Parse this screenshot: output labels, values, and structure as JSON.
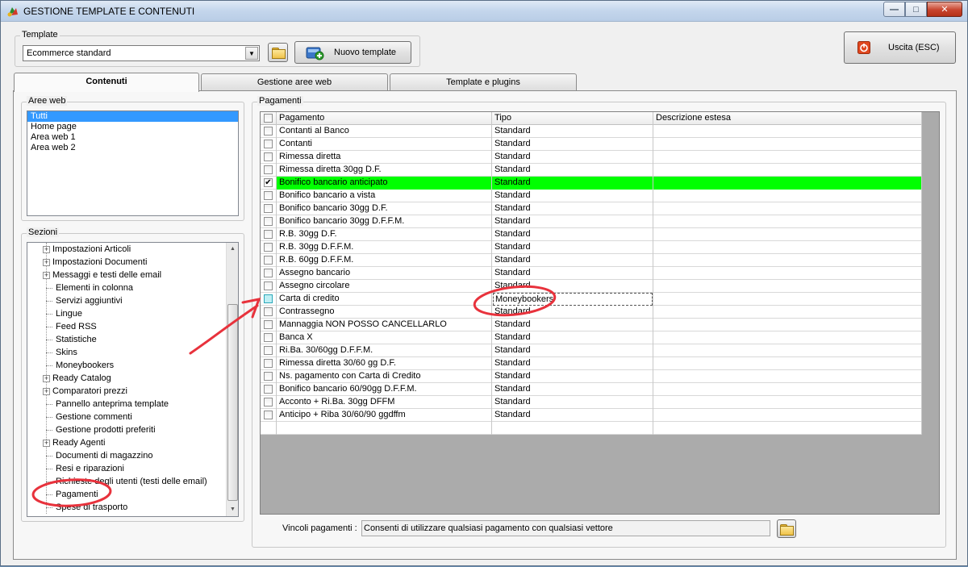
{
  "window": {
    "title": "GESTIONE TEMPLATE E CONTENUTI",
    "min_glyph": "—",
    "max_glyph": "□",
    "close_glyph": "✕"
  },
  "template": {
    "group_label": "Template",
    "selected": "Ecommerce standard",
    "new_button": "Nuovo template"
  },
  "exit_button": "Uscita (ESC)",
  "tabs": [
    {
      "label": "Contenuti",
      "active": true
    },
    {
      "label": "Gestione aree web",
      "active": false
    },
    {
      "label": "Template e plugins",
      "active": false
    }
  ],
  "aree_web": {
    "label": "Aree web",
    "items": [
      "Tutti",
      "Home page",
      "Area web 1",
      "Area web 2"
    ],
    "selected_index": 0
  },
  "sezioni": {
    "label": "Sezioni",
    "items": [
      {
        "label": "Impostazioni Articoli",
        "expandable": true
      },
      {
        "label": "Impostazioni Documenti",
        "expandable": true
      },
      {
        "label": "Messaggi e testi delle email",
        "expandable": true
      },
      {
        "label": "Elementi in colonna",
        "expandable": false
      },
      {
        "label": "Servizi aggiuntivi",
        "expandable": false
      },
      {
        "label": "Lingue",
        "expandable": false
      },
      {
        "label": "Feed RSS",
        "expandable": false
      },
      {
        "label": "Statistiche",
        "expandable": false
      },
      {
        "label": "Skins",
        "expandable": false
      },
      {
        "label": "Moneybookers",
        "expandable": false
      },
      {
        "label": "Ready Catalog",
        "expandable": true
      },
      {
        "label": "Comparatori prezzi",
        "expandable": true
      },
      {
        "label": "Pannello anteprima template",
        "expandable": false
      },
      {
        "label": "Gestione commenti",
        "expandable": false
      },
      {
        "label": "Gestione prodotti preferiti",
        "expandable": false
      },
      {
        "label": "Ready Agenti",
        "expandable": true
      },
      {
        "label": "Documenti di magazzino",
        "expandable": false
      },
      {
        "label": "Resi e riparazioni",
        "expandable": false
      },
      {
        "label": "Richieste degli utenti (testi delle email)",
        "expandable": false
      },
      {
        "label": "Pagamenti",
        "expandable": false
      },
      {
        "label": "Spese di trasporto",
        "expandable": false
      }
    ]
  },
  "pagamenti": {
    "label": "Pagamenti",
    "columns": [
      "Pagamento",
      "Tipo",
      "Descrizione estesa"
    ],
    "rows": [
      {
        "name": "Contanti al Banco",
        "tipo": "Standard",
        "checked": false
      },
      {
        "name": "Contanti",
        "tipo": "Standard",
        "checked": false
      },
      {
        "name": "Rimessa diretta",
        "tipo": "Standard",
        "checked": false
      },
      {
        "name": "Rimessa diretta 30gg D.F.",
        "tipo": "Standard",
        "checked": false
      },
      {
        "name": "Bonifico bancario anticipato",
        "tipo": "Standard",
        "checked": true,
        "highlight": true
      },
      {
        "name": "Bonifico bancario a vista",
        "tipo": "Standard",
        "checked": false
      },
      {
        "name": "Bonifico bancario 30gg D.F.",
        "tipo": "Standard",
        "checked": false
      },
      {
        "name": "Bonifico bancario 30gg D.F.F.M.",
        "tipo": "Standard",
        "checked": false
      },
      {
        "name": "R.B. 30gg D.F.",
        "tipo": "Standard",
        "checked": false
      },
      {
        "name": "R.B. 30gg D.F.F.M.",
        "tipo": "Standard",
        "checked": false
      },
      {
        "name": "R.B. 60gg D.F.F.M.",
        "tipo": "Standard",
        "checked": false
      },
      {
        "name": "Assegno bancario",
        "tipo": "Standard",
        "checked": false
      },
      {
        "name": "Assegno circolare",
        "tipo": "Standard",
        "checked": false
      },
      {
        "name": "Carta di credito",
        "tipo": "Moneybookers",
        "checked": false,
        "editing": true
      },
      {
        "name": "Contrassegno",
        "tipo": "Standard",
        "checked": false
      },
      {
        "name": "Mannaggia NON POSSO CANCELLARLO",
        "tipo": "Standard",
        "checked": false
      },
      {
        "name": "Banca X",
        "tipo": "Standard",
        "checked": false
      },
      {
        "name": "Ri.Ba. 30/60gg D.F.F.M.",
        "tipo": "Standard",
        "checked": false
      },
      {
        "name": "Rimessa diretta 30/60 gg D.F.",
        "tipo": "Standard",
        "checked": false
      },
      {
        "name": "Ns. pagamento con Carta di Credito",
        "tipo": "Standard",
        "checked": false
      },
      {
        "name": "Bonifico bancario 60/90gg D.F.F.M.",
        "tipo": "Standard",
        "checked": false
      },
      {
        "name": "Acconto +  Ri.Ba. 30gg DFFM",
        "tipo": "Standard",
        "checked": false
      },
      {
        "name": "Anticipo + Riba 30/60/90 ggdffm",
        "tipo": "Standard",
        "checked": false
      }
    ]
  },
  "vincoli": {
    "label": "Vincoli pagamenti :",
    "value": "Consenti di utilizzare qualsiasi pagamento con qualsiasi vettore"
  },
  "colors": {
    "highlight_row": "#00ff00",
    "selection": "#3399ff",
    "annotation": "#e8323c"
  }
}
